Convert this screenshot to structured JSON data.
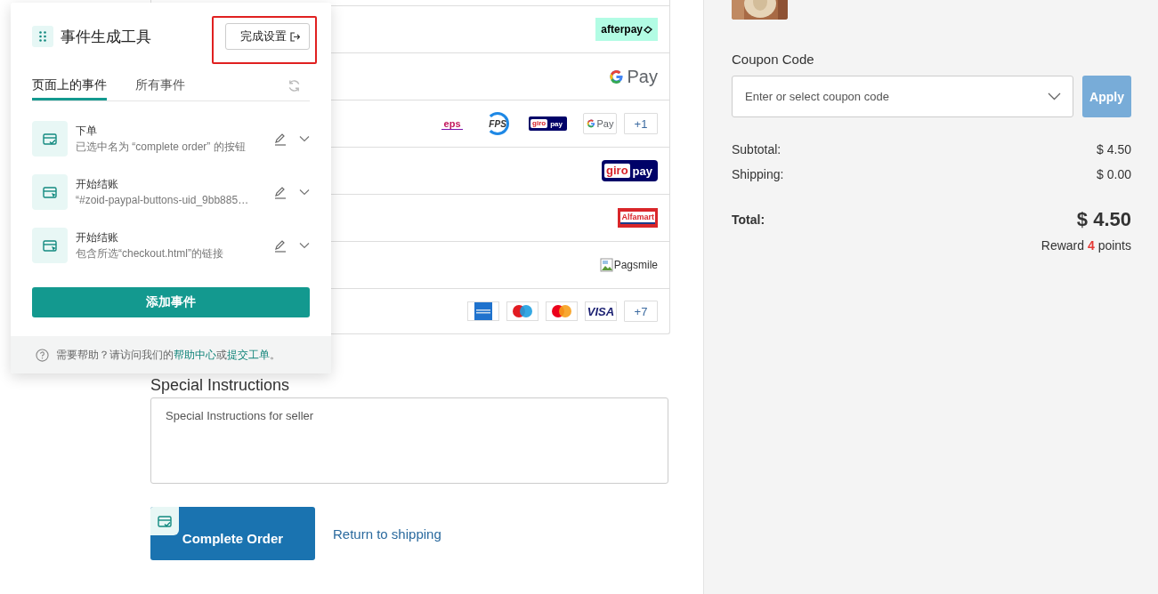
{
  "event_panel": {
    "title": "事件生成工具",
    "finish_button": "完成设置",
    "finish_highlighted": true,
    "tabs": [
      {
        "label": "页面上的事件",
        "selected": true
      },
      {
        "label": "所有事件",
        "selected": false
      }
    ],
    "events": [
      {
        "kind": "order",
        "title": "下单",
        "description": "已选中名为 “complete order” 的按钮"
      },
      {
        "kind": "checkout",
        "title": "开始结账",
        "description": "“#zoid-paypal-buttons-uid_9bb885…"
      },
      {
        "kind": "checkout",
        "title": "开始结账",
        "description": "包含所选“checkout.html”的链接"
      }
    ],
    "add_button": "添加事件",
    "help": {
      "before": "需要帮助？请访问我们的",
      "link_1": "帮助中心",
      "middle": "或",
      "link_2": "提交工单",
      "after": "。"
    }
  },
  "payment_methods": [
    {
      "logos": [
        {
          "kind": "afterpay",
          "text": "afterpay"
        }
      ]
    },
    {
      "logos": [
        {
          "kind": "gpay",
          "text": "Pay"
        }
      ]
    },
    {
      "logos": [
        {
          "kind": "eps",
          "text": "eps"
        },
        {
          "kind": "fps",
          "text": "FPS"
        },
        {
          "kind": "giropay",
          "parts": [
            "giro",
            "pay"
          ]
        },
        {
          "kind": "gpay_chip",
          "text": "Pay"
        },
        {
          "kind": "more",
          "text": "+1"
        }
      ]
    },
    {
      "logos": [
        {
          "kind": "giropay_large",
          "parts": [
            "giro",
            "pay"
          ]
        }
      ]
    },
    {
      "logos": [
        {
          "kind": "alfamart",
          "text": "Alfamart"
        }
      ]
    },
    {
      "logos": [
        {
          "kind": "broken_image",
          "text": "Pagsmile"
        }
      ]
    },
    {
      "logos": [
        {
          "kind": "amex"
        },
        {
          "kind": "maestro"
        },
        {
          "kind": "mastercard"
        },
        {
          "kind": "visa",
          "text": "VISA"
        },
        {
          "kind": "more",
          "text": "+7"
        }
      ]
    }
  ],
  "special_instructions": {
    "heading": "Special Instructions",
    "placeholder": "Special Instructions for seller"
  },
  "complete_button": "Complete Order",
  "return_link": "Return to shipping",
  "summary": {
    "coupon_label": "Coupon Code",
    "coupon_placeholder": "Enter or select coupon code",
    "apply_button": "Apply",
    "lines": [
      {
        "label": "Subtotal:",
        "value": "$ 4.50"
      },
      {
        "label": "Shipping:",
        "value": "$ 0.00"
      }
    ],
    "total_label": "Total:",
    "total_value": "$ 4.50",
    "reward": "Reward **4** points"
  }
}
